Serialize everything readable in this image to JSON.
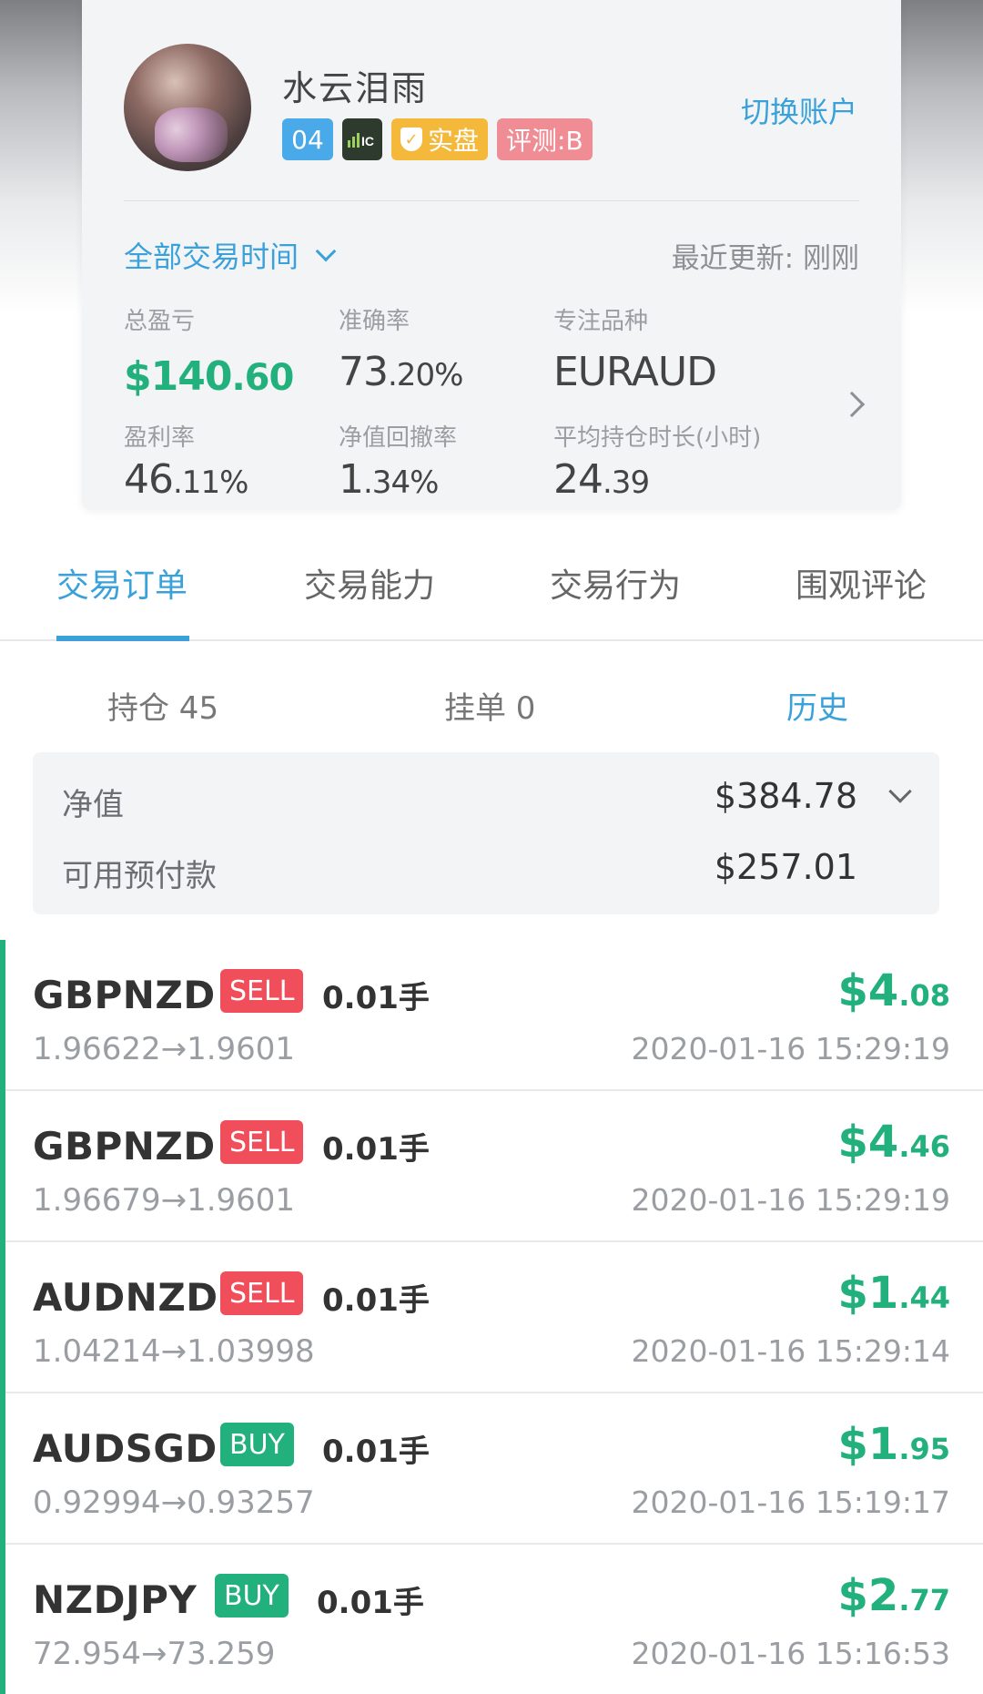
{
  "profile": {
    "username": "水云泪雨",
    "switch_account_label": "切换账户",
    "badges": {
      "level": "04",
      "broker": "IC",
      "real_label": "实盘",
      "rating_label": "评测:B"
    },
    "filter_label": "全部交易时间",
    "last_update": "最近更新: 刚刚",
    "stats": {
      "total_pnl_label": "总盈亏",
      "total_pnl_int": "$140",
      "total_pnl_dec": ".60",
      "accuracy_label": "准确率",
      "accuracy_int": "73",
      "accuracy_dec": ".20%",
      "focus_label": "专注品种",
      "focus_value": "EURAUD",
      "profit_rate_label": "盈利率",
      "profit_rate_int": "46",
      "profit_rate_dec": ".11%",
      "drawdown_label": "净值回撤率",
      "drawdown_int": "1",
      "drawdown_dec": ".34%",
      "avg_hold_label": "平均持仓时长(小时)",
      "avg_hold_int": "24",
      "avg_hold_dec": ".39"
    }
  },
  "tabs": {
    "orders": "交易订单",
    "ability": "交易能力",
    "behavior": "交易行为",
    "comments": "围观评论"
  },
  "subtabs": {
    "positions": "持仓 45",
    "pending": "挂单 0",
    "history": "历史"
  },
  "summary": {
    "equity_label": "净值",
    "equity_value": "$384.78",
    "available_label": "可用预付款",
    "available_value": "$257.01"
  },
  "orders": [
    {
      "symbol": "GBPNZD",
      "side": "SELL",
      "lots": "0.01手",
      "prices": "1.96622→1.9601",
      "pnl_int": "$4",
      "pnl_dec": ".08",
      "time": "2020-01-16 15:29:19"
    },
    {
      "symbol": "GBPNZD",
      "side": "SELL",
      "lots": "0.01手",
      "prices": "1.96679→1.9601",
      "pnl_int": "$4",
      "pnl_dec": ".46",
      "time": "2020-01-16 15:29:19"
    },
    {
      "symbol": "AUDNZD",
      "side": "SELL",
      "lots": "0.01手",
      "prices": "1.04214→1.03998",
      "pnl_int": "$1",
      "pnl_dec": ".44",
      "time": "2020-01-16 15:29:14"
    },
    {
      "symbol": "AUDSGD",
      "side": "BUY",
      "lots": "0.01手",
      "prices": "0.92994→0.93257",
      "pnl_int": "$1",
      "pnl_dec": ".95",
      "time": "2020-01-16 15:19:17"
    },
    {
      "symbol": "NZDJPY",
      "side": "BUY",
      "lots": "0.01手",
      "prices": "72.954→73.259",
      "pnl_int": "$2",
      "pnl_dec": ".77",
      "time": "2020-01-16 15:16:53"
    }
  ],
  "colors": {
    "accent": "#3aa1db",
    "profit": "#22b07d",
    "sell": "#f04e5a",
    "buy": "#22b07d"
  }
}
